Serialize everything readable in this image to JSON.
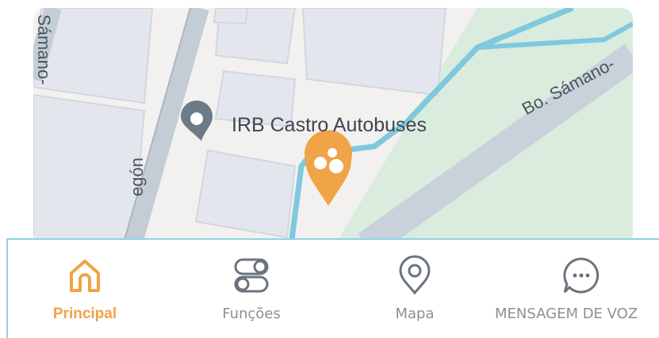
{
  "map": {
    "poi_name": "IRB Castro Autobuses",
    "street_labels": {
      "top_left": "Sámano-",
      "left_vertical": "egón",
      "right": "Bo. Sámano-"
    },
    "pin_color": "#f0a347",
    "poi_marker_color": "#6b7b88"
  },
  "tabbar": {
    "accent_color": "#f0a347",
    "tabs": [
      {
        "label": "Principal",
        "icon": "home-icon",
        "active": true
      },
      {
        "label": "Funções",
        "icon": "toggles-icon",
        "active": false
      },
      {
        "label": "Mapa",
        "icon": "map-pin-icon",
        "active": false
      },
      {
        "label": "MENSAGEM DE VOZ",
        "icon": "chat-bubble-icon",
        "active": false
      }
    ]
  }
}
